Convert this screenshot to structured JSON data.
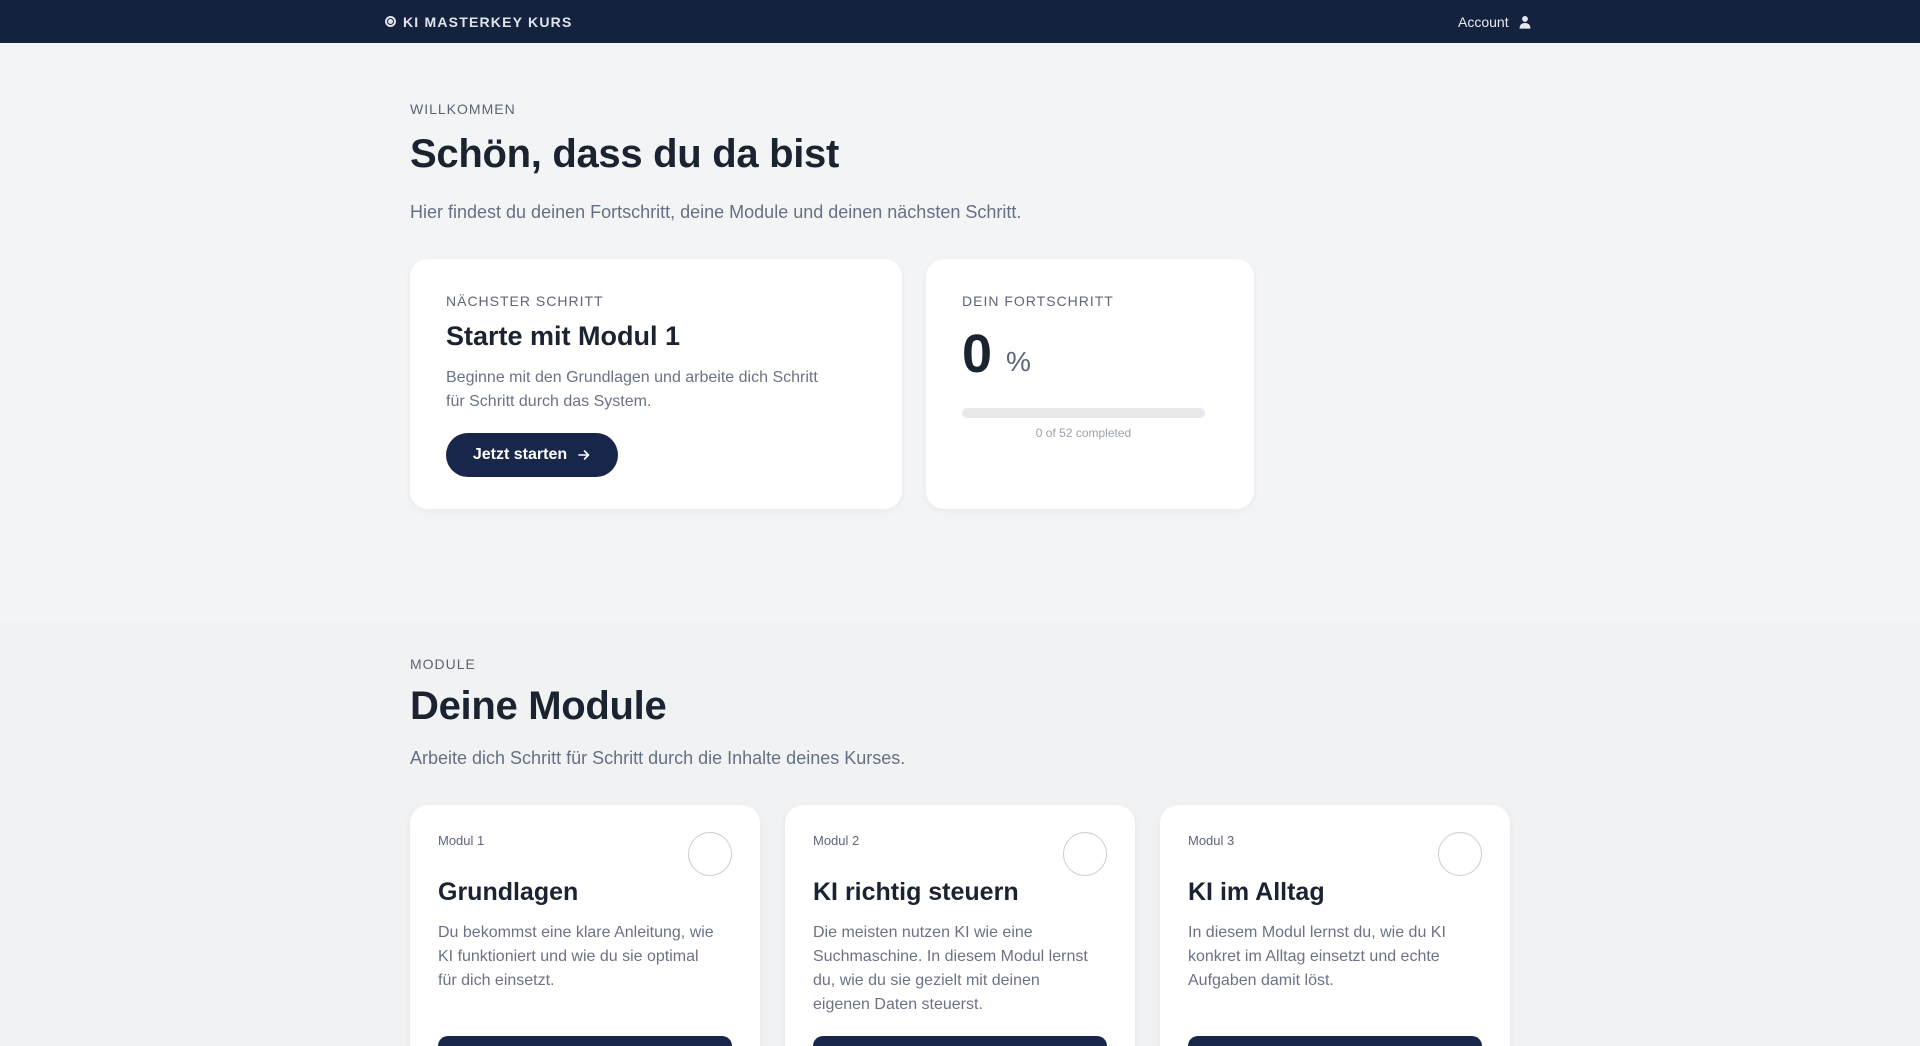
{
  "nav": {
    "brand": "KI MASTERKEY KURS",
    "account_label": "Account"
  },
  "welcome": {
    "eyebrow": "WILLKOMMEN",
    "title": "Schön, dass du da bist",
    "lead": "Hier findest du deinen Fortschritt, deine Module und deinen nächsten Schritt."
  },
  "next_step": {
    "eyebrow": "NÄCHSTER SCHRITT",
    "title": "Starte mit Modul 1",
    "desc_line1": "Beginne mit den Grundlagen und arbeite dich Schritt",
    "desc_line2": "für Schritt durch das System.",
    "button_label": "Jetzt starten"
  },
  "progress": {
    "eyebrow": "DEIN FORTSCHRITT",
    "value": "0",
    "unit": "%",
    "fraction": 0,
    "caption": "0 of 52 completed"
  },
  "modules_section": {
    "eyebrow": "MODULE",
    "title": "Deine Module",
    "lead": "Arbeite dich Schritt für Schritt durch die Inhalte deines Kurses."
  },
  "modules": [
    {
      "label": "Modul 1",
      "title": "Grundlagen",
      "desc": [
        "Du bekommst eine klare Anleitung, wie",
        "KI funktioniert und wie du sie optimal",
        "für dich einsetzt."
      ]
    },
    {
      "label": "Modul 2",
      "title": "KI richtig steuern",
      "desc": [
        "Die meisten nutzen KI wie eine",
        "Suchmaschine. In diesem Modul lernst",
        "du, wie du sie gezielt mit deinen",
        "eigenen Daten steuerst."
      ]
    },
    {
      "label": "Modul 3",
      "title": "KI im Alltag",
      "desc": [
        "In diesem Modul lernst du, wie du KI",
        "konkret im Alltag einsetzt und echte",
        "Aufgaben damit löst."
      ]
    }
  ],
  "colors": {
    "nav_bg": "#15223d",
    "page_bg": "#f3f4f6",
    "accent": "#18264a"
  }
}
